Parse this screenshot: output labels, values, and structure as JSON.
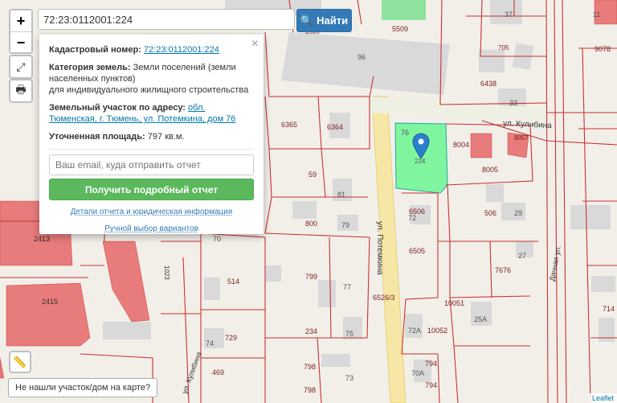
{
  "search": {
    "value": "72:23:0112001:224",
    "button_label": "Найти"
  },
  "controls": {
    "zoom_in": "+",
    "zoom_out": "−"
  },
  "popup": {
    "close": "×",
    "cadastral_label": "Кадастровый номер:",
    "cadastral_value": "72:23:0112001:224",
    "category_label": "Категория земель:",
    "category_value_1": "Земли поселений (земли населенных пунктов)",
    "category_value_2": "для индивидуального жилищного строительства",
    "address_label": "Земельный участок по адресу:",
    "address_value": "обл. Тюменская, г. Тюмень, ул. Потемкина, дом 76",
    "area_label": "Уточненная площадь:",
    "area_value": "797 кв.м.",
    "email_placeholder": "Ваш email, куда отправить отчет",
    "get_report": "Получить подробный отчет",
    "details_link": "Детали отчета и юридическая информация",
    "manual_link": "Ручной выбор вариантов"
  },
  "not_found": "Не нашли участок/дом на карте?",
  "attribution": "Leaflet",
  "map_labels": {
    "street_kulibina": "ул. Кулибина",
    "street_potemkina": "ул. Потемкина",
    "street_dachnaya": "Дачная ул.",
    "street_kulibina_2": "ул. Кулибина",
    "selected_parcel": "224",
    "p5509": "5509",
    "p37": "37",
    "p11": "11",
    "p3569": "3569",
    "p96": "96",
    "p705": "705",
    "p9078": "9078",
    "p6438": "6438",
    "p33": "33",
    "p6365": "6365",
    "p6364": "6364",
    "p76": "76",
    "p8004": "8004",
    "p8057": "8057",
    "p8005": "8005",
    "p59": "59",
    "p81": "81",
    "p6506": "6506",
    "p72": "72",
    "p506": "506",
    "p29": "29",
    "p800": "800",
    "p79": "79",
    "p70": "70",
    "p6505": "6505",
    "p27": "27",
    "p7676": "7676",
    "p514": "514",
    "p799": "799",
    "p77": "77",
    "p6526": "6526/3",
    "p10051": "10051",
    "p714": "714",
    "p2415": "2415",
    "p2413": "2413",
    "p1023": "1023",
    "p729": "729",
    "p74": "74",
    "p234": "234",
    "p75": "75",
    "p72a": "72А",
    "p10052": "10052",
    "p25a": "25А",
    "p469": "469",
    "p798": "798",
    "p73": "73",
    "p794": "794",
    "p70a": "70А",
    "p794b": "794",
    "p798b": "798"
  }
}
